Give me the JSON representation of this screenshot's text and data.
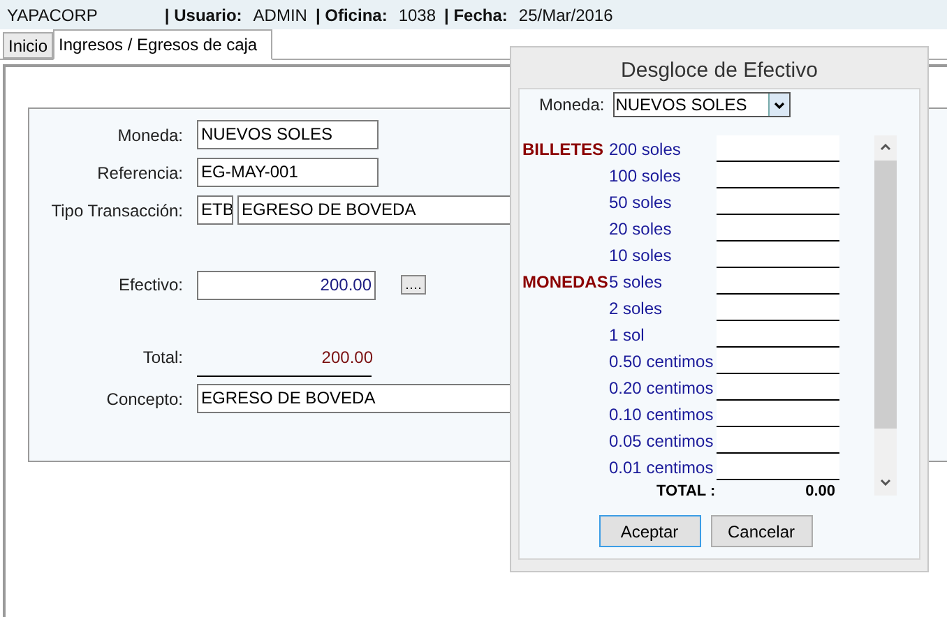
{
  "header": {
    "company": "YAPACORP",
    "fields": [
      {
        "label": "| Usuario:",
        "value": "ADMIN"
      },
      {
        "label": "| Oficina:",
        "value": "1038"
      },
      {
        "label": "| Fecha:",
        "value": "25/Mar/2016"
      }
    ]
  },
  "tabs": [
    {
      "label": "Inicio",
      "selected": false
    },
    {
      "label": "Ingresos / Egresos de caja",
      "selected": true
    }
  ],
  "form": {
    "moneda": {
      "label": "Moneda:",
      "value": "NUEVOS SOLES"
    },
    "referencia": {
      "label": "Referencia:",
      "value": "EG-MAY-001"
    },
    "tipo": {
      "label": "Tipo Transacción:",
      "code": "ETB",
      "value": "EGRESO DE BOVEDA"
    },
    "efectivo": {
      "label": "Efectivo:",
      "value": "200.00"
    },
    "total": {
      "label": "Total:",
      "value": "200.00"
    },
    "concepto": {
      "label": "Concepto:",
      "value": "EGRESO DE BOVEDA"
    }
  },
  "dialog": {
    "title": "Desgloce de Efectivo",
    "moneda_label": "Moneda:",
    "moneda_value": "NUEVOS SOLES",
    "rows": [
      {
        "category": "BILLETES",
        "denomination": "200 soles"
      },
      {
        "denomination": "100 soles"
      },
      {
        "denomination": "50 soles"
      },
      {
        "denomination": "20 soles"
      },
      {
        "denomination": "10 soles"
      },
      {
        "category": "MONEDAS",
        "denomination": "5 soles"
      },
      {
        "denomination": "2 soles"
      },
      {
        "denomination": "1 sol"
      },
      {
        "denomination": "0.50 centimos"
      },
      {
        "denomination": "0.20 centimos"
      },
      {
        "denomination": "0.10 centimos"
      },
      {
        "denomination": "0.05 centimos"
      },
      {
        "denomination": "0.01 centimos"
      }
    ],
    "total_label": "TOTAL :",
    "total_value": "0.00",
    "buttons": [
      {
        "label": "Aceptar",
        "focused": true
      },
      {
        "label": "Cancelar",
        "focused": false
      }
    ]
  }
}
